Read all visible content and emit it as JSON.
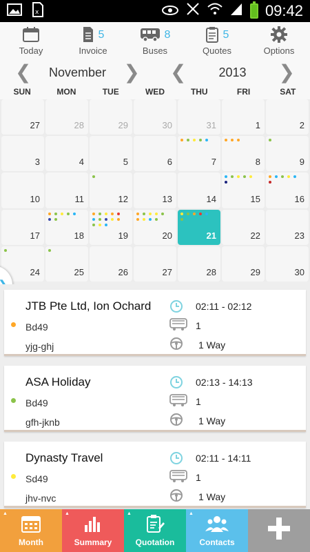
{
  "status_bar": {
    "time": "09:42"
  },
  "toolbar": [
    {
      "label": "Today",
      "count": "",
      "icon": "calendar-icon"
    },
    {
      "label": "Invoice",
      "count": "5",
      "icon": "document-icon"
    },
    {
      "label": "Buses",
      "count": "8",
      "icon": "bus-icon"
    },
    {
      "label": "Quotes",
      "count": "5",
      "icon": "clipboard-icon"
    },
    {
      "label": "Options",
      "count": "",
      "icon": "gear-icon"
    }
  ],
  "period": {
    "month": "November",
    "year": "2013"
  },
  "weekdays": [
    "SUN",
    "MON",
    "TUE",
    "WED",
    "THU",
    "FRI",
    "SAT"
  ],
  "calendar": {
    "selected_day": "21",
    "days": [
      {
        "num": "27",
        "muted": false,
        "dots": []
      },
      {
        "num": "28",
        "muted": true,
        "dots": []
      },
      {
        "num": "29",
        "muted": true,
        "dots": []
      },
      {
        "num": "30",
        "muted": true,
        "dots": []
      },
      {
        "num": "31",
        "muted": true,
        "dots": []
      },
      {
        "num": "1",
        "muted": false,
        "dots": []
      },
      {
        "num": "2",
        "muted": false,
        "dots": []
      },
      {
        "num": "3",
        "muted": false,
        "dots": []
      },
      {
        "num": "4",
        "muted": false,
        "dots": []
      },
      {
        "num": "5",
        "muted": false,
        "dots": []
      },
      {
        "num": "6",
        "muted": false,
        "dots": []
      },
      {
        "num": "7",
        "muted": false,
        "dots": [
          "#ffa726",
          "#8bc34a",
          "#ffeb3b",
          "#8bc34a",
          "#29b6f6"
        ]
      },
      {
        "num": "8",
        "muted": false,
        "dots": [
          "#ffa726",
          "#ffa726",
          "#ffa726"
        ]
      },
      {
        "num": "9",
        "muted": false,
        "dots": [
          "#8bc34a"
        ]
      },
      {
        "num": "10",
        "muted": false,
        "dots": []
      },
      {
        "num": "11",
        "muted": false,
        "dots": []
      },
      {
        "num": "12",
        "muted": false,
        "dots": [
          "#8bc34a"
        ]
      },
      {
        "num": "13",
        "muted": false,
        "dots": []
      },
      {
        "num": "14",
        "muted": false,
        "dots": []
      },
      {
        "num": "15",
        "muted": false,
        "dots": [
          "#29b6f6",
          "#8bc34a",
          "#ffeb3b",
          "#8bc34a",
          "#ffeb3b",
          "#1a237e"
        ]
      },
      {
        "num": "16",
        "muted": false,
        "dots": [
          "#ffa726",
          "#29b6f6",
          "#8bc34a",
          "#ffeb3b",
          "#29b6f6",
          "#c62828"
        ]
      },
      {
        "num": "17",
        "muted": false,
        "dots": []
      },
      {
        "num": "18",
        "muted": false,
        "dots": [
          "#ffa726",
          "#8bc34a",
          "#ffeb3b",
          "#8bc34a",
          "#29b6f6",
          "#3949ab",
          "#8bc34a"
        ]
      },
      {
        "num": "19",
        "muted": false,
        "dots": [
          "#ffa726",
          "#8bc34a",
          "#ffeb3b",
          "#ffa726",
          "#e53935",
          "#29b6f6",
          "#8bc34a",
          "#3949ab",
          "#ffeb3b",
          "#ffa726",
          "#8bc34a",
          "#ffeb3b",
          "#29b6f6"
        ]
      },
      {
        "num": "20",
        "muted": false,
        "dots": [
          "#ffa726",
          "#8bc34a",
          "#ffeb3b",
          "#ffeb3b",
          "#8bc34a",
          "#ffa726",
          "#ffeb3b",
          "#29b6f6",
          "#8bc34a"
        ]
      },
      {
        "num": "21",
        "muted": false,
        "dots": [
          "#ffeb3b",
          "#8bc34a",
          "#ffa726",
          "#e53935",
          "#29b6f6",
          "#8bc34a"
        ]
      },
      {
        "num": "22",
        "muted": false,
        "dots": []
      },
      {
        "num": "23",
        "muted": false,
        "dots": []
      },
      {
        "num": "24",
        "muted": false,
        "dots": [
          "#8bc34a"
        ]
      },
      {
        "num": "25",
        "muted": false,
        "dots": [
          "#8bc34a"
        ]
      },
      {
        "num": "26",
        "muted": false,
        "dots": []
      },
      {
        "num": "27",
        "muted": false,
        "dots": []
      },
      {
        "num": "28",
        "muted": false,
        "dots": []
      },
      {
        "num": "29",
        "muted": false,
        "dots": []
      },
      {
        "num": "30",
        "muted": false,
        "dots": []
      }
    ]
  },
  "bookings": [
    {
      "company": "JTB Pte Ltd, Ion Ochard",
      "code": "Bd49",
      "ref": "yjg-ghj",
      "time": "02:11 - 02:12",
      "buses": "1",
      "trip": "1 Way",
      "color": "#ffa726"
    },
    {
      "company": "ASA Holiday",
      "code": "Bd49",
      "ref": "gfh-jknb",
      "time": "02:13 - 14:13",
      "buses": "1",
      "trip": "1 Way",
      "color": "#8bc34a"
    },
    {
      "company": "Dynasty Travel",
      "code": "Sd49",
      "ref": "jhv-nvc",
      "time": "02:11 - 14:11",
      "buses": "1",
      "trip": "1 Way",
      "color": "#ffeb3b"
    }
  ],
  "bottom_nav": [
    {
      "label": "Month",
      "color": "#f2a03d",
      "icon": "calendar-icon"
    },
    {
      "label": "Summary",
      "color": "#ef5a5a",
      "icon": "bar-chart-icon"
    },
    {
      "label": "Quotation",
      "color": "#1abc9c",
      "icon": "clipboard-edit-icon"
    },
    {
      "label": "Contacts",
      "color": "#5bc0eb",
      "icon": "people-icon"
    },
    {
      "label": "",
      "color": "#9e9e9e",
      "icon": "plus-icon"
    }
  ]
}
